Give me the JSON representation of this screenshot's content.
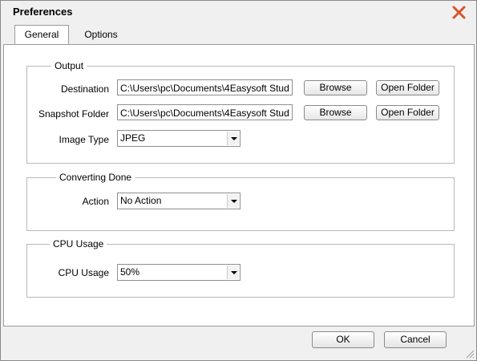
{
  "window": {
    "title": "Preferences"
  },
  "tabs": [
    {
      "label": "General",
      "active": true
    },
    {
      "label": "Options",
      "active": false
    }
  ],
  "output": {
    "group_title": "Output",
    "destination_label": "Destination",
    "destination_value": "C:\\Users\\pc\\Documents\\4Easysoft Stud",
    "snapshot_label": "Snapshot Folder",
    "snapshot_value": "C:\\Users\\pc\\Documents\\4Easysoft Stud",
    "browse_label": "Browse",
    "open_folder_label": "Open Folder",
    "image_type_label": "Image Type",
    "image_type_value": "JPEG"
  },
  "converting_done": {
    "group_title": "Converting Done",
    "action_label": "Action",
    "action_value": "No Action"
  },
  "cpu_usage": {
    "group_title": "CPU Usage",
    "label": "CPU Usage",
    "value": "50%"
  },
  "footer": {
    "ok_label": "OK",
    "cancel_label": "Cancel"
  },
  "colors": {
    "close_icon": "#d9542b",
    "window_bg": "#f0f0f0",
    "content_bg": "#ffffff"
  }
}
